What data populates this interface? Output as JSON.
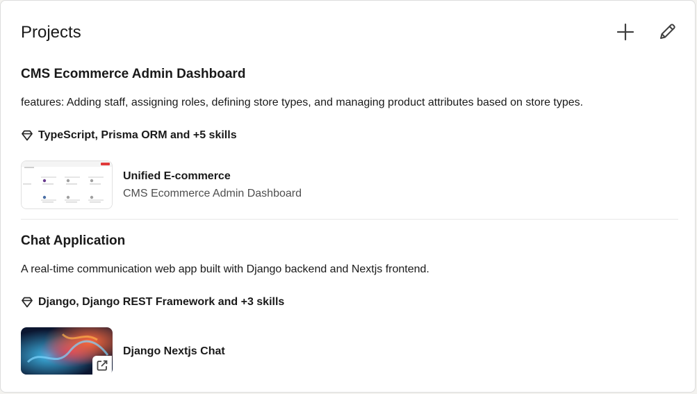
{
  "section": {
    "title": "Projects"
  },
  "projects": [
    {
      "title": "CMS Ecommerce Admin Dashboard",
      "description": "features: Adding staff, assigning roles, defining store types, and managing product attributes based on store types.",
      "skills": "TypeScript, Prisma ORM and +5 skills",
      "media": {
        "title": "Unified E-commerce",
        "subtitle": "CMS Ecommerce Admin Dashboard"
      }
    },
    {
      "title": "Chat Application",
      "description": "A real-time communication web app built with Django backend and Nextjs frontend.",
      "skills": "Django, Django REST Framework and +3 skills",
      "media": {
        "title": "Django Nextjs Chat",
        "subtitle": ""
      }
    }
  ],
  "icons": {
    "add": "plus-icon",
    "edit": "pencil-icon",
    "skills": "gem-icon",
    "external": "external-link-icon"
  },
  "colors": {
    "text": "#191919",
    "divider": "#e8e8e8",
    "card_bg": "#ffffff",
    "page_bg": "#f3f2ef"
  }
}
